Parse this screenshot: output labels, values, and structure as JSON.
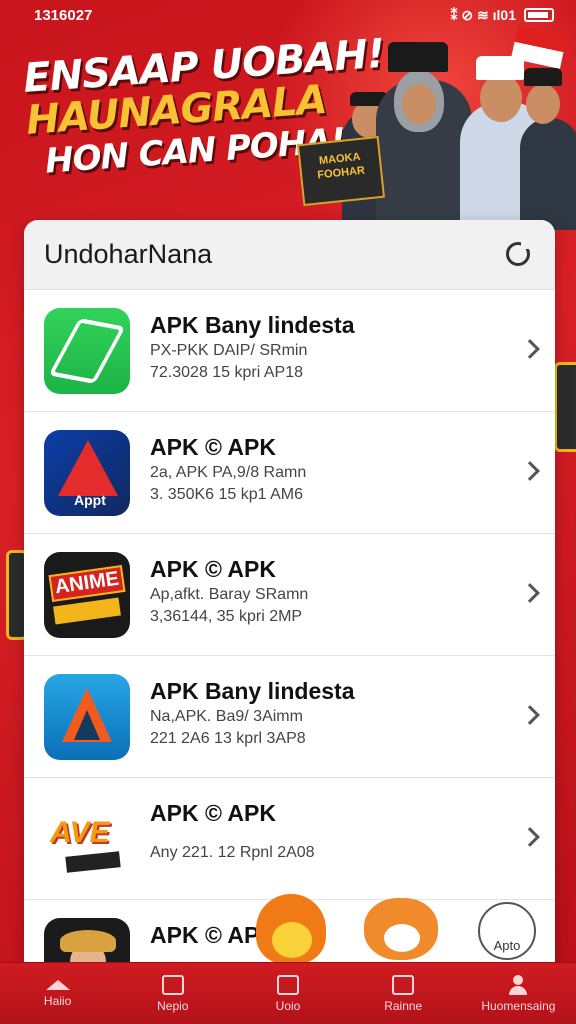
{
  "status_bar": {
    "time": "1316027",
    "indicators": "⁑ ⊘ ≋ ıl01"
  },
  "banner": {
    "headline_line1": "ENSAAP UOBAH!",
    "headline_line2": "HAUNAGRALA",
    "headline_line3": "HON CAN POHA!!",
    "sign_text": "MAOKA FOOHAR"
  },
  "card": {
    "title": "UndoharNana"
  },
  "apps": [
    {
      "title": "APK Bany lindesta",
      "line1": "PX-PKK DAIP/ SRmin",
      "line2": "72.3028 15 kpri AP18",
      "icon": "green-arrow-icon"
    },
    {
      "title": "APK © APK",
      "line1": "2a, APK PA,9/8 Ramn",
      "line2": "3. 350K6 15 kp1 AM6",
      "icon": "blue-red-a-icon",
      "icon_label": "Appt"
    },
    {
      "title": "APK © APK",
      "line1": "Ap,afkt. Baray SRamn",
      "line2": "3,36144, 35 kpri 2MP",
      "icon": "anime-badge-icon",
      "icon_label": "ANIME"
    },
    {
      "title": "APK Bany lindesta",
      "line1": "Na,APK. Ba9/ 3Aimm",
      "line2": "221 2A6 13 kprl 3AP8",
      "icon": "blue-orange-a-icon"
    },
    {
      "title": "APK © APK",
      "line1": "",
      "line2": "Any 221. 12 Rpnl 2A08",
      "icon": "ave-logo-icon",
      "icon_label": "AVE"
    },
    {
      "title": "APK © AP",
      "line1": "",
      "line2": "",
      "icon": "person-avatar-icon"
    }
  ],
  "extras": {
    "apto_label": "Apto"
  },
  "bottom_nav": [
    {
      "label": "Haiio",
      "icon": "home-icon"
    },
    {
      "label": "Nepio",
      "icon": "grid-icon"
    },
    {
      "label": "Uoio",
      "icon": "card-icon"
    },
    {
      "label": "Rainne",
      "icon": "bookmark-icon"
    },
    {
      "label": "Huomensaing",
      "icon": "profile-icon"
    }
  ]
}
